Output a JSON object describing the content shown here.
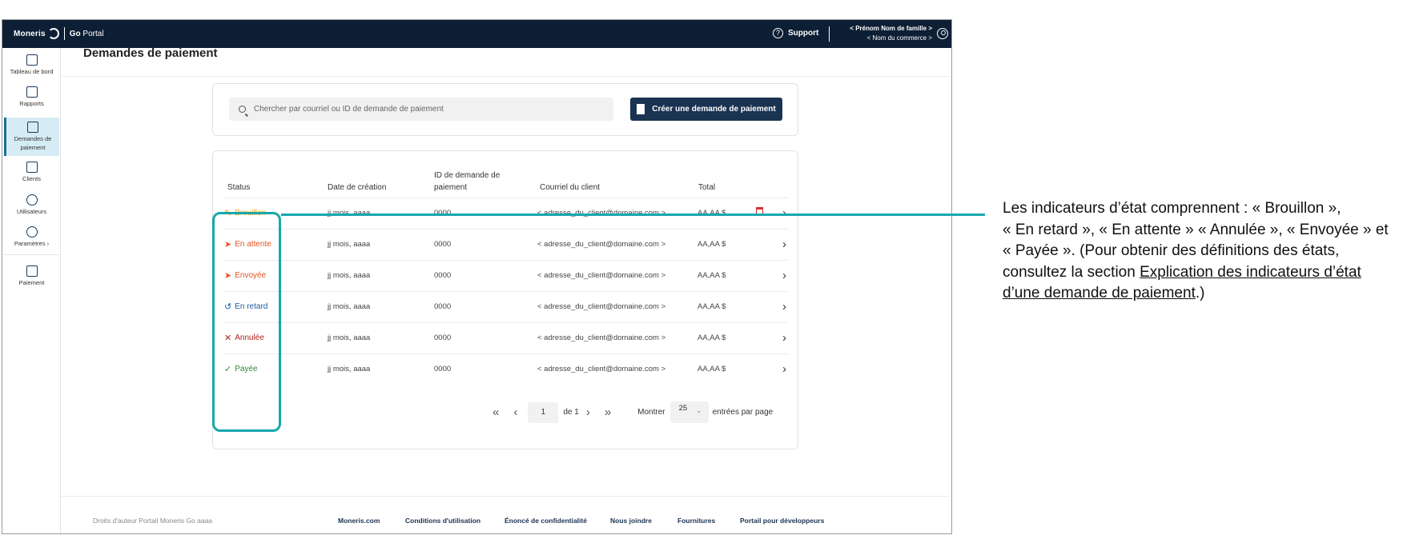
{
  "topbar": {
    "brand": "Moneris",
    "product_prefix": "Go",
    "product_suffix": "Portal",
    "support_label": "Support",
    "user_name": "< Prénom Nom de famille >",
    "business_name": "< Nom du commerce >"
  },
  "sidebar": {
    "items": [
      {
        "label": "Tableau de bord",
        "icon": "dashboard-icon"
      },
      {
        "label": "Rapports",
        "icon": "report-icon"
      },
      {
        "label": "Demandes de paiement",
        "icon": "payment-request-icon",
        "active": true
      },
      {
        "label": "Clients",
        "icon": "clients-icon"
      },
      {
        "label": "Utilisateurs",
        "icon": "users-icon"
      },
      {
        "label": "Paramètres ›",
        "icon": "settings-icon"
      },
      {
        "label": "Paiement",
        "icon": "payment-icon"
      }
    ]
  },
  "page": {
    "title": "Demandes de paiement",
    "search_placeholder": "Chercher par courriel ou ID de demande de paiement",
    "create_button": "Créer une demande de paiement"
  },
  "table": {
    "headers": {
      "status": "Status",
      "date": "Date de création",
      "id": "ID de demande de paiement",
      "email": "Courriel du client",
      "total": "Total"
    },
    "rows": [
      {
        "status": "Brouillon",
        "glyph": "✎",
        "color": "#f5a000",
        "date": "jj mois, aaaa",
        "id": "0000",
        "email": "< adresse_du_client@domaine.com >",
        "total": "AA,AA $"
      },
      {
        "status": "En attente",
        "glyph": "➤",
        "color": "#e8531f",
        "date": "jj mois, aaaa",
        "id": "0000",
        "email": "< adresse_du_client@domaine.com >",
        "total": "AA,AA $"
      },
      {
        "status": "Envoyée",
        "glyph": "➤",
        "color": "#e8531f",
        "date": "jj mois, aaaa",
        "id": "0000",
        "email": "< adresse_du_client@domaine.com >",
        "total": "AA,AA $"
      },
      {
        "status": "En retard",
        "glyph": "↺",
        "color": "#1e5a9e",
        "date": "jj mois, aaaa",
        "id": "0000",
        "email": "< adresse_du_client@domaine.com >",
        "total": "AA,AA $"
      },
      {
        "status": "Annulée",
        "glyph": "✕",
        "color": "#b0231f",
        "date": "jj mois, aaaa",
        "id": "0000",
        "email": "< adresse_du_client@domaine.com >",
        "total": "AA,AA $"
      },
      {
        "status": "Payée",
        "glyph": "✓",
        "color": "#2e8b2e",
        "date": "jj mois, aaaa",
        "id": "0000",
        "email": "< adresse_du_client@domaine.com >",
        "total": "AA,AA $"
      }
    ]
  },
  "pagination": {
    "page": "1",
    "of_label": "de 1",
    "show_label": "Montrer",
    "per_page": "25",
    "per_page_label": "entrées par page"
  },
  "footer": {
    "copyright": "Droits d'auteur Portail Moneris Go aaaa",
    "links": [
      "Moneris.com",
      "Conditions d'utilisation",
      "Énoncé de confidentialité",
      "Nous joindre",
      "Fournitures",
      "Portail pour développeurs"
    ]
  },
  "annotation": {
    "line1": "Les indicateurs d’état comprennent : « Brouillon »,",
    "line2": "« En retard », « En attente » « Annulée », « Envoyée » et",
    "line3": "« Payée ». (Pour obtenir des définitions des états,",
    "line4_prefix": "consultez la section ",
    "link_part1": "Explication des indicateurs d’état",
    "link_part2": "d’une demande de paiement",
    "line5_suffix": ".)"
  },
  "colors": {
    "topbar": "#0d1f35",
    "accent_teal": "#17a8ad",
    "button": "#1b3352",
    "delete": "#d32f2f"
  }
}
